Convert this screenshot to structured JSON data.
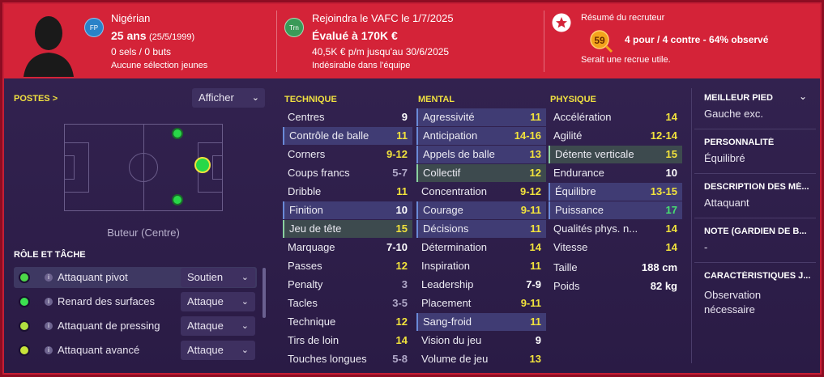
{
  "header": {
    "nationality": "Nigérian",
    "nationality_badge": "FP",
    "age": "25 ans",
    "dob": "(25/5/1999)",
    "caps": "0 sels / 0 buts",
    "youth_caps": "Aucune sélection jeunes",
    "club_badge": "Trn",
    "join": "Rejoindra le VAFC le 1/7/2025",
    "value": "Évalué à 170K €",
    "wage": "40,5K € p/m jusqu'au 30/6/2025",
    "status": "Indésirable dans l'équipe",
    "scout_title": "Résumé du recruteur",
    "scout_score": "59",
    "scout_summary": "4 pour / 4 contre - 64% observé",
    "scout_note": "Serait une recrue utile."
  },
  "positions": {
    "title": "POSTES",
    "chevron": ">",
    "dropdown_label": "Afficher",
    "position_label": "Buteur (Centre)"
  },
  "roles": {
    "title": "RÔLE ET TÂCHE",
    "items": [
      {
        "name": "Attaquant pivot",
        "duty": "Soutien",
        "color": "#4cd848"
      },
      {
        "name": "Renard des surfaces",
        "duty": "Attaque",
        "color": "#3ce050"
      },
      {
        "name": "Attaquant de pressing",
        "duty": "Attaque",
        "color": "#b0e040"
      },
      {
        "name": "Attaquant avancé",
        "duty": "Attaque",
        "color": "#c8e43a"
      }
    ]
  },
  "technique": {
    "title": "TECHNIQUE",
    "attrs": [
      {
        "name": "Centres",
        "value": "9"
      },
      {
        "name": "Contrôle de balle",
        "value": "11"
      },
      {
        "name": "Corners",
        "value": "9-12"
      },
      {
        "name": "Coups francs",
        "value": "5-7"
      },
      {
        "name": "Dribble",
        "value": "11"
      },
      {
        "name": "Finition",
        "value": "10"
      },
      {
        "name": "Jeu de tête",
        "value": "15"
      },
      {
        "name": "Marquage",
        "value": "7-10"
      },
      {
        "name": "Passes",
        "value": "12"
      },
      {
        "name": "Penalty",
        "value": "3"
      },
      {
        "name": "Tacles",
        "value": "3-5"
      },
      {
        "name": "Technique",
        "value": "12"
      },
      {
        "name": "Tirs de loin",
        "value": "14"
      },
      {
        "name": "Touches longues",
        "value": "5-8"
      }
    ]
  },
  "mental": {
    "title": "MENTAL",
    "attrs": [
      {
        "name": "Agressivité",
        "value": "11"
      },
      {
        "name": "Anticipation",
        "value": "14-16"
      },
      {
        "name": "Appels de balle",
        "value": "13"
      },
      {
        "name": "Collectif",
        "value": "12"
      },
      {
        "name": "Concentration",
        "value": "9-12"
      },
      {
        "name": "Courage",
        "value": "9-11"
      },
      {
        "name": "Décisions",
        "value": "11"
      },
      {
        "name": "Détermination",
        "value": "14"
      },
      {
        "name": "Inspiration",
        "value": "11"
      },
      {
        "name": "Leadership",
        "value": "7-9"
      },
      {
        "name": "Placement",
        "value": "9-11"
      },
      {
        "name": "Sang-froid",
        "value": "11"
      },
      {
        "name": "Vision du jeu",
        "value": "9"
      },
      {
        "name": "Volume de jeu",
        "value": "13"
      }
    ]
  },
  "physique": {
    "title": "PHYSIQUE",
    "attrs": [
      {
        "name": "Accélération",
        "value": "14"
      },
      {
        "name": "Agilité",
        "value": "12-14"
      },
      {
        "name": "Détente verticale",
        "value": "15"
      },
      {
        "name": "Endurance",
        "value": "10"
      },
      {
        "name": "Équilibre",
        "value": "13-15"
      },
      {
        "name": "Puissance",
        "value": "17"
      },
      {
        "name": "Qualités phys. n...",
        "value": "14"
      },
      {
        "name": "Vitesse",
        "value": "14"
      }
    ],
    "height_label": "Taille",
    "height": "188 cm",
    "weight_label": "Poids",
    "weight": "82 kg"
  },
  "right_panel": {
    "foot_title": "MEILLEUR PIED",
    "foot_value": "Gauche exc.",
    "personality_title": "PERSONNALITÉ",
    "personality_value": "Équilibré",
    "media_title": "DESCRIPTION DES MÉ...",
    "media_value": "Attaquant",
    "gk_title": "NOTE (GARDIEN DE B...",
    "gk_value": "-",
    "traits_title": "CARACTÉRISTIQUES J...",
    "traits_value_1": "Observation",
    "traits_value_2": "nécessaire"
  }
}
